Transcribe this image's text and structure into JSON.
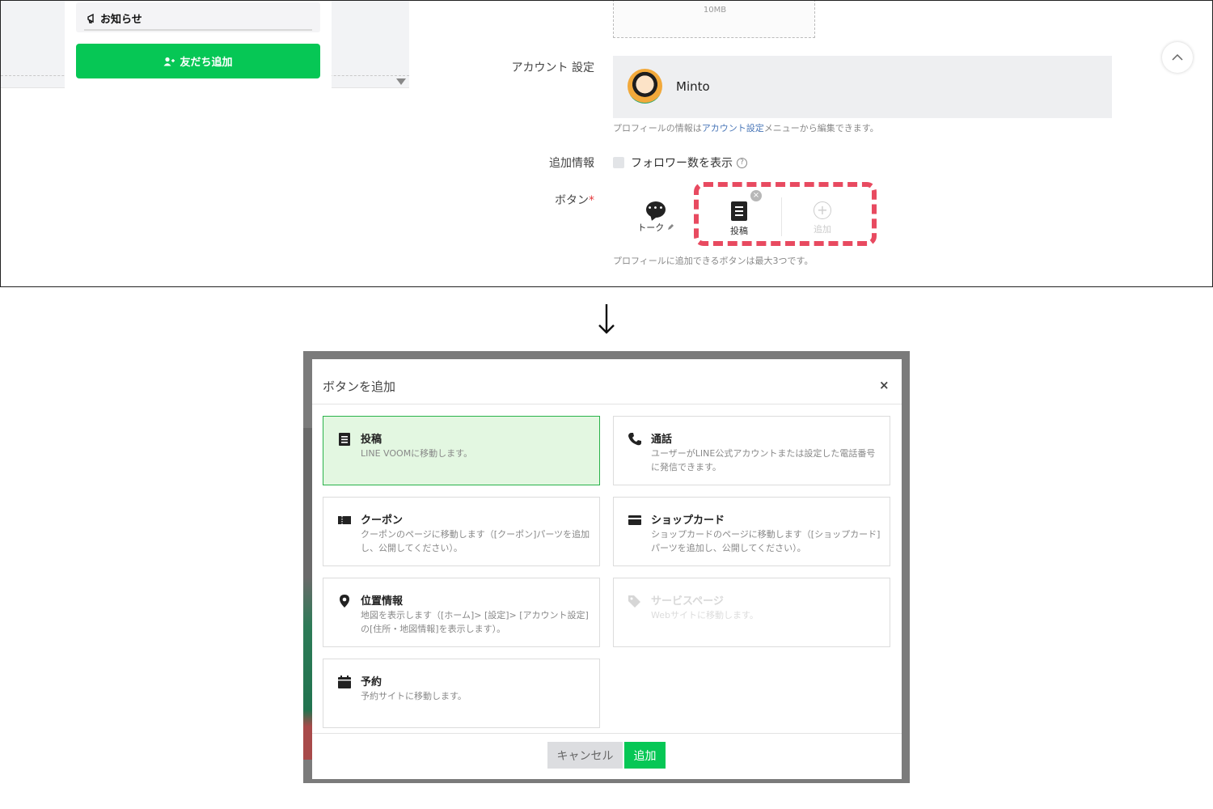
{
  "top": {
    "phone": {
      "notice_title": "お知らせ",
      "add_friend_label": "友だち追加"
    },
    "upload_size": "10MB",
    "account_label": "アカウント 設定",
    "account_name": "Minto",
    "account_hint_prefix": "プロフィールの情報は",
    "account_hint_link": "アカウント設定",
    "account_hint_suffix": "メニューから編集できます。",
    "extra_label": "追加情報",
    "follower_label": "フォロワー数を表示",
    "buttons_label": "ボタン",
    "required_mark": "*",
    "buttons": {
      "talk": "トーク",
      "post": "投稿",
      "add": "追加"
    },
    "buttons_hint": "プロフィールに追加できるボタンは最大3つです。",
    "highlight_color": "#e84a60"
  },
  "modal": {
    "title": "ボタンを追加",
    "close": "×",
    "options": [
      {
        "icon": "document-icon",
        "title": "投稿",
        "desc": "LINE VOOMに移動します。",
        "state": "selected"
      },
      {
        "icon": "phone-icon",
        "title": "通話",
        "desc": "ユーザーがLINE公式アカウントまたは設定した電話番号に発信できます。",
        "state": "normal"
      },
      {
        "icon": "coupon-icon",
        "title": "クーポン",
        "desc": "クーポンのページに移動します（[クーポン]パーツを追加し、公開してください）。",
        "state": "normal"
      },
      {
        "icon": "shop-card-icon",
        "title": "ショップカード",
        "desc": "ショップカードのページに移動します（[ショップカード]パーツを追加し、公開してください）。",
        "state": "normal"
      },
      {
        "icon": "location-pin-icon",
        "title": "位置情報",
        "desc": "地図を表示します（[ホーム]> [設定]> [アカウント設定]の[住所・地図情報]を表示します）。",
        "state": "normal"
      },
      {
        "icon": "tag-icon",
        "title": "サービスページ",
        "desc": "Webサイトに移動します。",
        "state": "disabled"
      },
      {
        "icon": "calendar-icon",
        "title": "予約",
        "desc": "予約サイトに移動します。",
        "state": "normal"
      }
    ],
    "cancel_label": "キャンセル",
    "add_label": "追加",
    "accent_color": "#06c755"
  }
}
